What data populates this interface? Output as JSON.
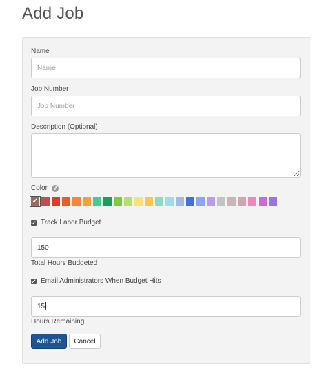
{
  "page": {
    "title": "Add Job"
  },
  "form": {
    "name": {
      "label": "Name",
      "placeholder": "Name",
      "value": ""
    },
    "job_number": {
      "label": "Job Number",
      "placeholder": "Job Number",
      "value": ""
    },
    "description": {
      "label": "Description (Optional)",
      "value": ""
    },
    "color": {
      "label": "Color",
      "help_glyph": "?",
      "selected_index": 0,
      "check_glyph": "✓",
      "swatches": [
        "#a06a5a",
        "#c0504d",
        "#e03c2c",
        "#f05a28",
        "#f7853a",
        "#f5a03c",
        "#3fcf8e",
        "#1a9f5b",
        "#7ccd3c",
        "#b6e06a",
        "#f7e27b",
        "#f5c84e",
        "#8fd9c0",
        "#9edde6",
        "#9dbbe4",
        "#3f72dd",
        "#8ca4f4",
        "#b79cf2",
        "#c3c3c3",
        "#c7b7b7",
        "#d6a3ad",
        "#f288b9",
        "#c86be0",
        "#9b73e3"
      ]
    },
    "track_labor": {
      "label": "Track Labor Budget",
      "checked": true
    },
    "total_hours": {
      "value": "150",
      "caption": "Total Hours Budgeted"
    },
    "email_admins": {
      "label": "Email Administrators When Budget Hits",
      "checked": true
    },
    "hours_remaining": {
      "value": "15",
      "caption": "Hours Remaining"
    }
  },
  "actions": {
    "submit_label": "Add Job",
    "cancel_label": "Cancel"
  }
}
